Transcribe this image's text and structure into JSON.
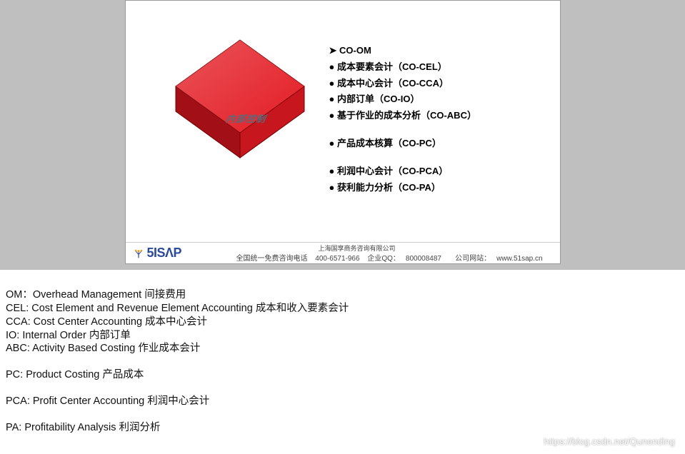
{
  "slide": {
    "cube_label": "内部控制",
    "bullets": [
      {
        "style": "arrow",
        "text": "CO-OM"
      },
      {
        "style": "dot",
        "text": "成本要素会计（CO-CEL）"
      },
      {
        "style": "dot",
        "text": "成本中心会计（CO-CCA）"
      },
      {
        "style": "dot",
        "text": "内部订单（CO-IO）"
      },
      {
        "style": "dot",
        "text": "基于作业的成本分析（CO-ABC）"
      },
      {
        "style": "gap",
        "text": ""
      },
      {
        "style": "dot",
        "text": "产品成本核算（CO-PC）"
      },
      {
        "style": "gap",
        "text": ""
      },
      {
        "style": "dot",
        "text": "利润中心会计（CO-PCA）"
      },
      {
        "style": "dot",
        "text": "获利能力分析（CO-PA）"
      }
    ],
    "footer": {
      "logo_text": "5ISΛP",
      "company": "上海国享商务咨询有限公司",
      "hotline_label": "全国统一免费咨询电话",
      "hotline": "400-6571-966",
      "qq_label": "企业QQ：",
      "qq": "800008487",
      "site_label": "公司网站：",
      "site": "www.51sap.cn"
    }
  },
  "notes": {
    "lines": [
      "OM：Overhead Management  间接费用",
      "CEL: Cost Element and Revenue Element Accounting 成本和收入要素会计",
      "CCA: Cost Center Accounting 成本中心会计",
      "IO: Internal Order  内部订单",
      "ABC: Activity Based Costing  作业成本会计",
      "",
      "PC: Product Costing  产品成本",
      "",
      "PCA: Profit Center Accounting  利润中心会计",
      "",
      "PA: Profitability Analysis  利润分析"
    ]
  },
  "watermark": "https://blog.csdn.net/Qunending"
}
